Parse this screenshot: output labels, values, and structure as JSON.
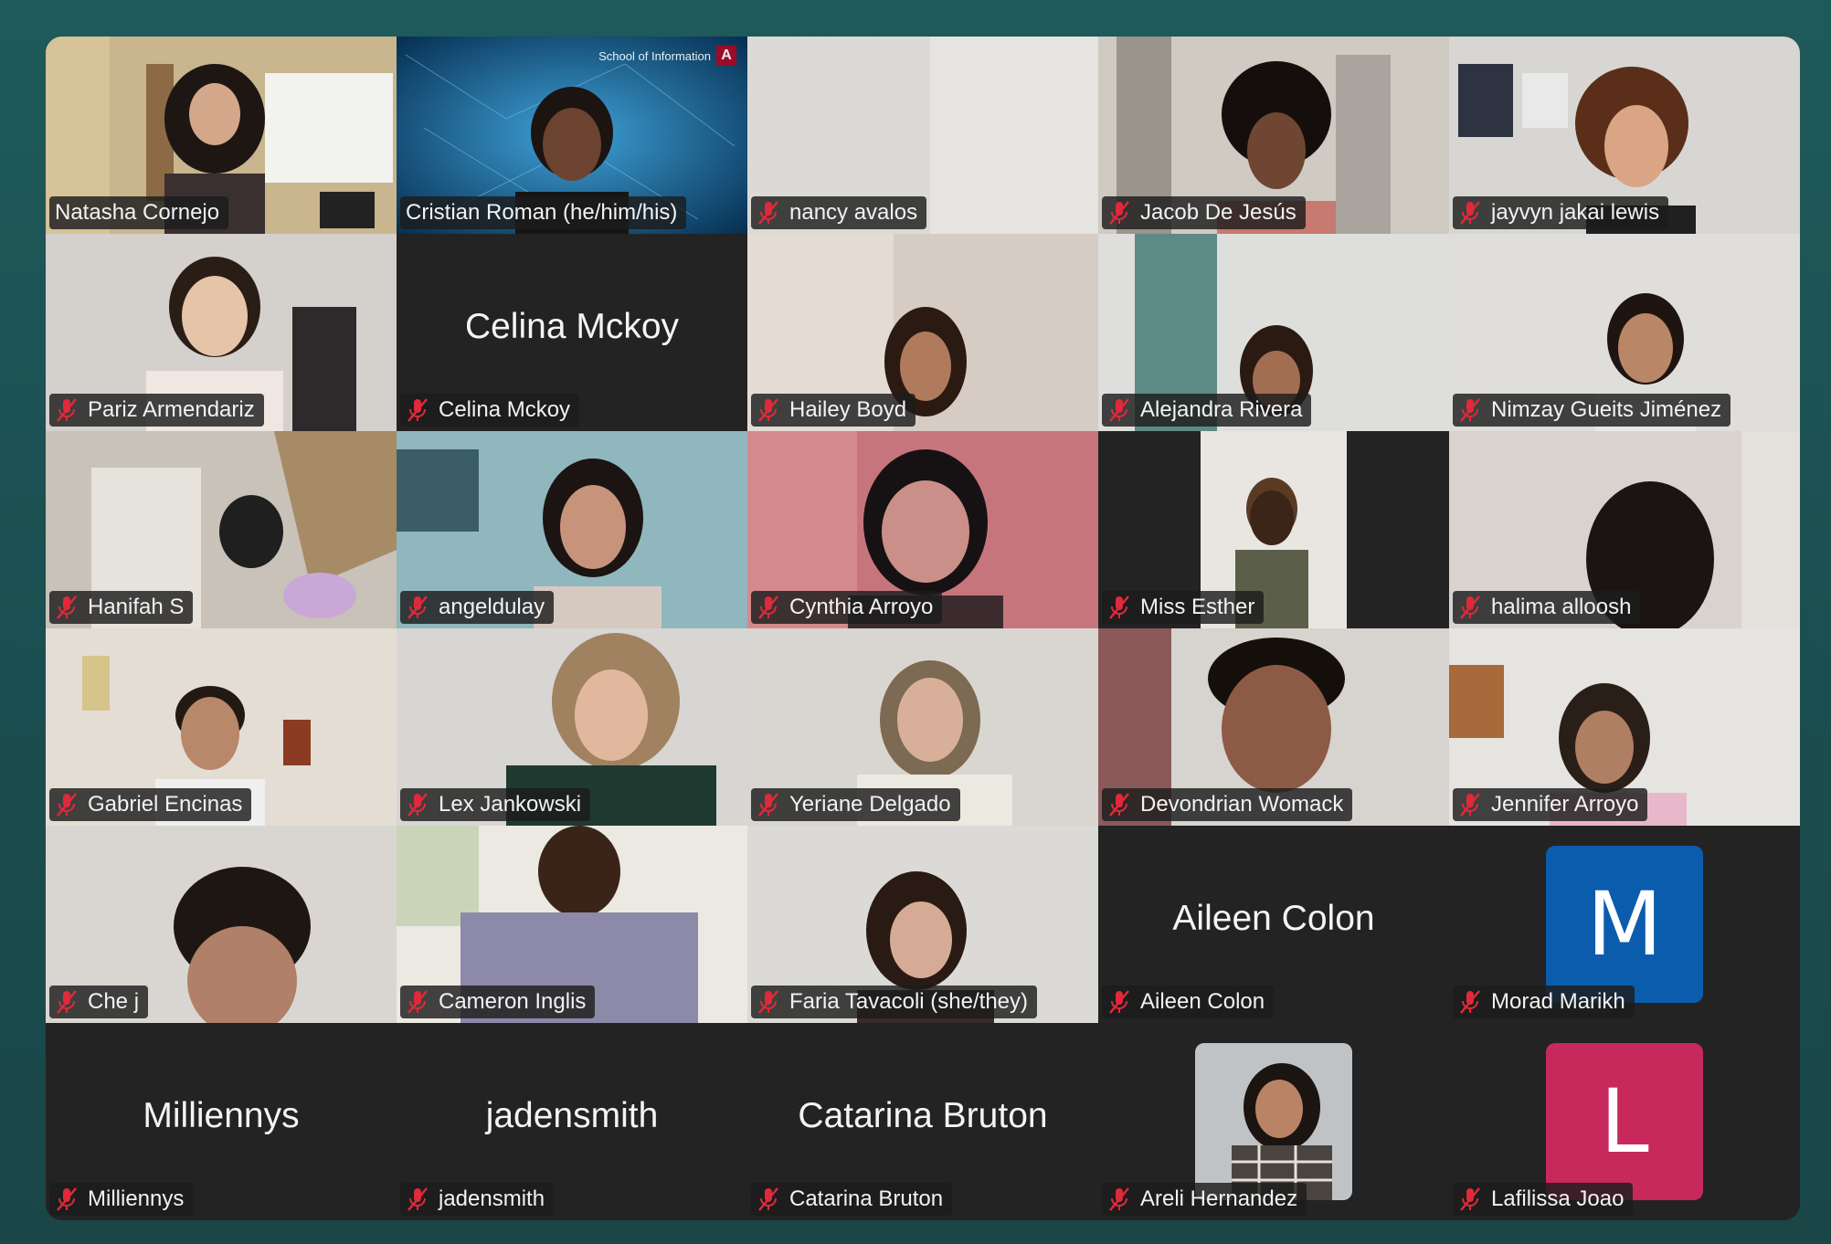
{
  "participants": [
    {
      "name": "Natasha Cornejo",
      "muted": false,
      "video": true,
      "active_speaker": true
    },
    {
      "name": "Cristian Roman (he/him/his)",
      "muted": false,
      "video": true
    },
    {
      "name": "nancy avalos",
      "muted": true,
      "video": true
    },
    {
      "name": "Jacob De Jesús",
      "muted": true,
      "video": true
    },
    {
      "name": "jayvyn jakai lewis",
      "muted": true,
      "video": true
    },
    {
      "name": "Pariz Armendariz",
      "muted": true,
      "video": true
    },
    {
      "name": "Celina Mckoy",
      "muted": true,
      "video": false,
      "display_name": "Celina Mckoy"
    },
    {
      "name": "Hailey Boyd",
      "muted": true,
      "video": true
    },
    {
      "name": "Alejandra Rivera",
      "muted": true,
      "video": true
    },
    {
      "name": "Nimzay Gueits Jiménez",
      "muted": true,
      "video": true
    },
    {
      "name": "Hanifah S",
      "muted": true,
      "video": true
    },
    {
      "name": "angeldulay",
      "muted": true,
      "video": true
    },
    {
      "name": "Cynthia Arroyo",
      "muted": true,
      "video": true
    },
    {
      "name": "Miss Esther",
      "muted": true,
      "video": true
    },
    {
      "name": "halima alloosh",
      "muted": true,
      "video": true
    },
    {
      "name": "Gabriel Encinas",
      "muted": true,
      "video": true
    },
    {
      "name": "Lex Jankowski",
      "muted": true,
      "video": true
    },
    {
      "name": "Yeriane Delgado",
      "muted": true,
      "video": true
    },
    {
      "name": "Devondrian Womack",
      "muted": true,
      "video": true
    },
    {
      "name": "Jennifer Arroyo",
      "muted": true,
      "video": true
    },
    {
      "name": "Che j",
      "muted": true,
      "video": true
    },
    {
      "name": "Cameron Inglis",
      "muted": true,
      "video": true
    },
    {
      "name": "Faria Tavacoli (she/they)",
      "muted": true,
      "video": true
    },
    {
      "name": "Aileen Colon",
      "muted": true,
      "video": false,
      "display_name": "Aileen Colon"
    },
    {
      "name": "Morad Marikh",
      "muted": true,
      "video": false,
      "avatar_letter": "M",
      "avatar_color": "#0b5cad"
    },
    {
      "name": "Milliennys",
      "muted": true,
      "video": false,
      "display_name": "Milliennys"
    },
    {
      "name": "jadensmith",
      "muted": true,
      "video": false,
      "display_name": "jadensmith"
    },
    {
      "name": "Catarina Bruton",
      "muted": true,
      "video": false,
      "display_name": "Catarina Bruton"
    },
    {
      "name": "Areli Hernandez",
      "muted": true,
      "video": false,
      "avatar_photo": true
    },
    {
      "name": "Lafilissa Joao",
      "muted": true,
      "video": false,
      "avatar_letter": "L",
      "avatar_color": "#c7295d"
    }
  ],
  "virtual_background_logo": "School of Information",
  "colors": {
    "active_speaker_border": "#3ecf5c",
    "muted_icon": "#e0293a"
  }
}
